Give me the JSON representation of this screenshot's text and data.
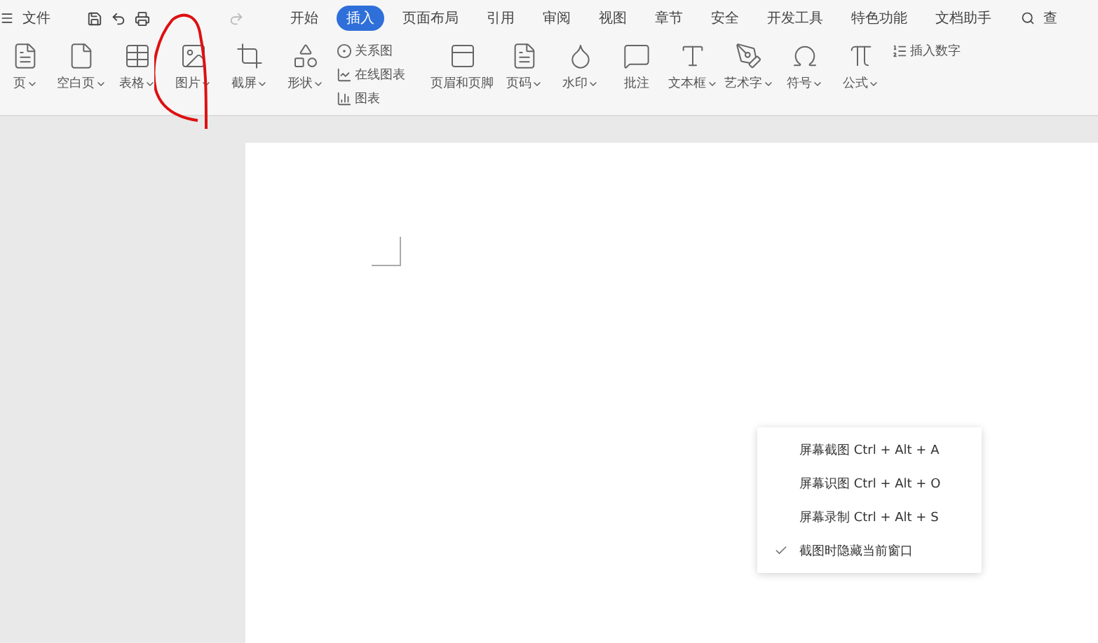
{
  "menu_bar": {
    "file": "文件",
    "tabs": [
      {
        "label": "开始",
        "selected": false
      },
      {
        "label": "插入",
        "selected": true
      },
      {
        "label": "页面布局",
        "selected": false
      },
      {
        "label": "引用",
        "selected": false
      },
      {
        "label": "审阅",
        "selected": false
      },
      {
        "label": "视图",
        "selected": false
      },
      {
        "label": "章节",
        "selected": false
      },
      {
        "label": "安全",
        "selected": false
      },
      {
        "label": "开发工具",
        "selected": false
      },
      {
        "label": "特色功能",
        "selected": false
      },
      {
        "label": "文档助手",
        "selected": false
      }
    ],
    "search": "查"
  },
  "ribbon": {
    "large": [
      {
        "kind": "pagebreak",
        "label": "页",
        "dropdown": true
      },
      {
        "kind": "blank",
        "label": "空白页",
        "dropdown": true
      },
      {
        "kind": "table",
        "label": "表格",
        "dropdown": true
      },
      {
        "kind": "picture",
        "label": "图片",
        "dropdown": true
      },
      {
        "kind": "crop",
        "label": "截屏",
        "dropdown": true
      },
      {
        "kind": "shape",
        "label": "形状",
        "dropdown": true
      }
    ],
    "small": [
      {
        "kind": "diagram",
        "label": "关系图"
      },
      {
        "kind": "online",
        "label": "在线图表"
      },
      {
        "kind": "chart",
        "label": "图表"
      }
    ],
    "large2": [
      {
        "kind": "header",
        "label": "页眉和页脚",
        "dropdown": false
      },
      {
        "kind": "page",
        "label": "页码",
        "dropdown": true
      },
      {
        "kind": "watermark",
        "label": "水印",
        "dropdown": true
      },
      {
        "kind": "comment",
        "label": "批注",
        "dropdown": false
      },
      {
        "kind": "textbox",
        "label": "文本框",
        "dropdown": true
      },
      {
        "kind": "art",
        "label": "艺术字",
        "dropdown": true
      },
      {
        "kind": "symbol",
        "label": "符号",
        "dropdown": true
      },
      {
        "kind": "formula",
        "label": "公式",
        "dropdown": true
      }
    ],
    "small2": [
      {
        "kind": "number",
        "label": "插入数字"
      }
    ]
  },
  "context_menu": {
    "items": [
      {
        "label": "屏幕截图",
        "shortcut": "Ctrl + Alt + A",
        "checked": false
      },
      {
        "label": "屏幕识图",
        "shortcut": "Ctrl + Alt + O",
        "checked": false
      },
      {
        "label": "屏幕录制",
        "shortcut": "Ctrl + Alt + S",
        "checked": false
      },
      {
        "label": "截图时隐藏当前窗口",
        "checked": true
      }
    ]
  }
}
